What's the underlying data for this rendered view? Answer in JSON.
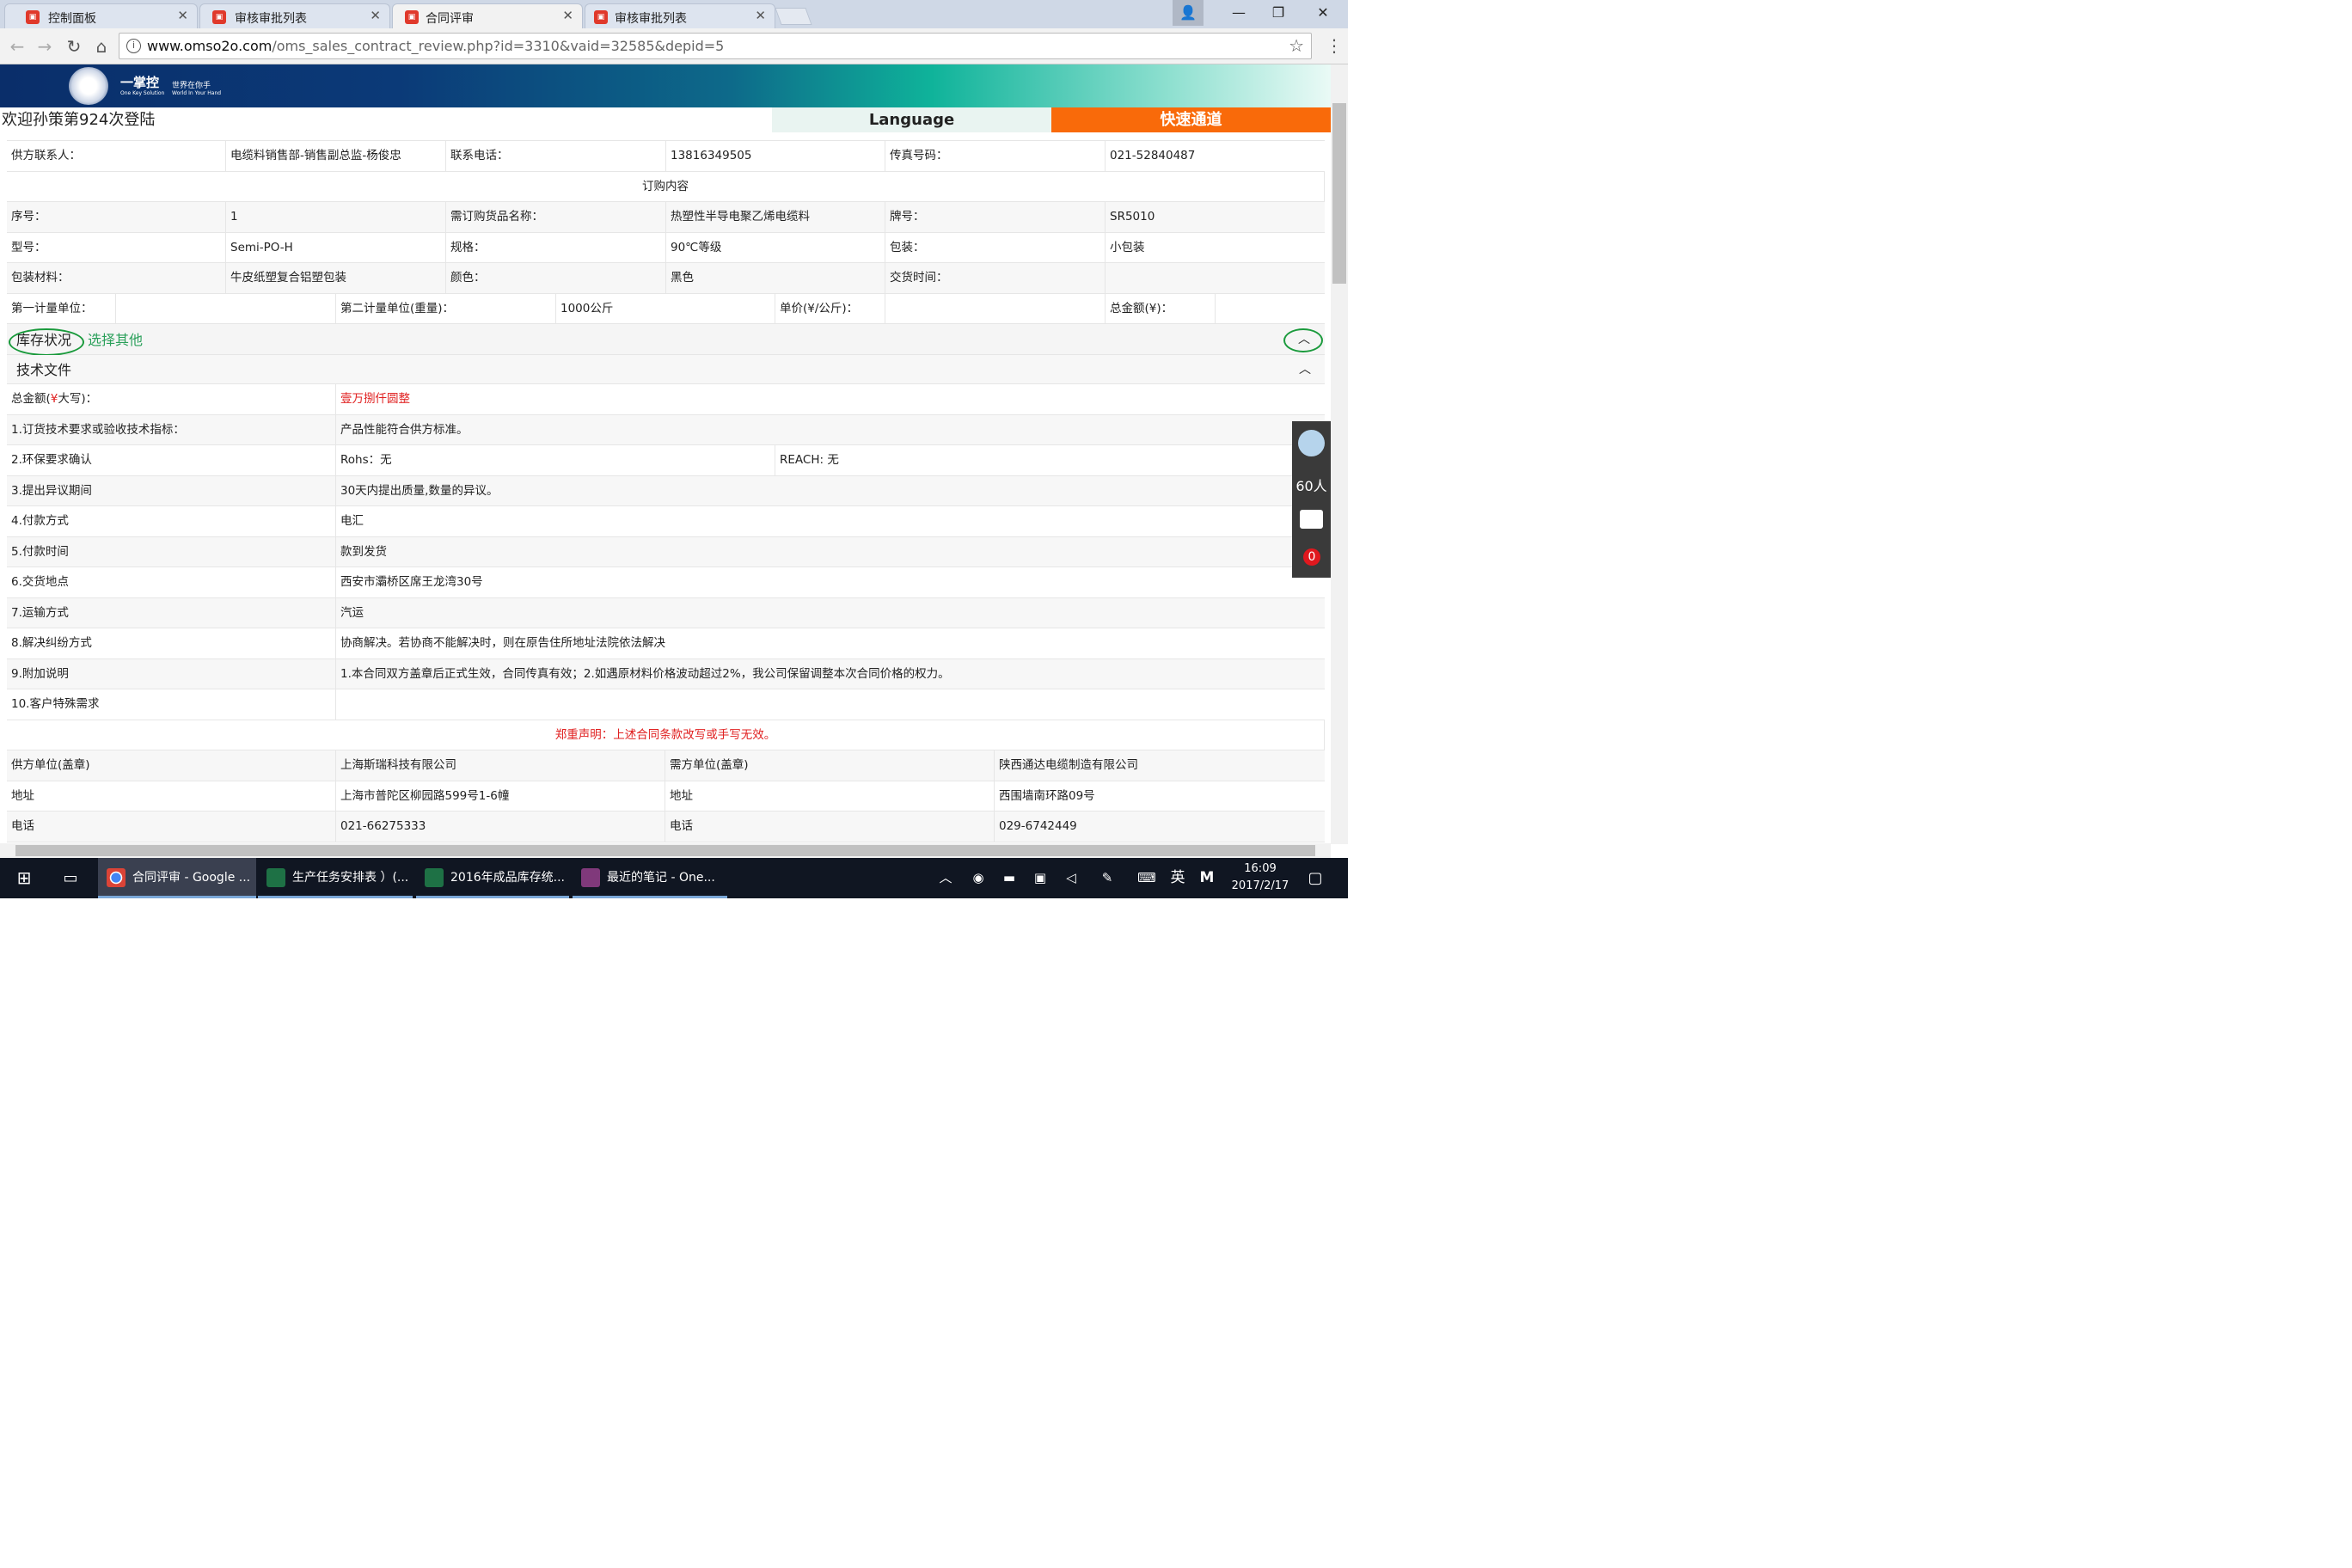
{
  "browser": {
    "tabs": [
      {
        "label": "控制面板",
        "active": false
      },
      {
        "label": "审核审批列表",
        "active": false
      },
      {
        "label": "合同评审",
        "active": true
      },
      {
        "label": "审核审批列表",
        "active": false
      }
    ],
    "url_host": "www.omso2o.com",
    "url_rest": "/oms_sales_contract_review.php?id=3310&vaid=32585&depid=5"
  },
  "banner": {
    "brand": "一掌控",
    "slogan": "世界在你手",
    "sub_brand": "One Key Solution",
    "sub_slogan": "World In Your Hand"
  },
  "header": {
    "welcome": "欢迎孙策第924次登陆",
    "language": "Language",
    "fast_channel": "快速通道"
  },
  "supplier_contact": {
    "label": "供方联系人：",
    "value": "电缆料销售部-销售副总监-杨俊忠",
    "phone_label": "联系电话：",
    "phone": "13816349505",
    "fax_label": "传真号码：",
    "fax": "021-52840487"
  },
  "order": {
    "section_title": "订购内容",
    "seq_label": "序号：",
    "seq": "1",
    "product_label": "需订购货品名称：",
    "product": "热塑性半导电聚乙烯电缆料",
    "brand_label": "牌号：",
    "brand": "SR5010",
    "model_label": "型号：",
    "model": "Semi-PO-H",
    "spec_label": "规格：",
    "spec": "90℃等级",
    "pack_label": "包装：",
    "pack": "小包装",
    "pack_material_label": "包装材料：",
    "pack_material": "牛皮纸塑复合铝塑包装",
    "color_label": "颜色：",
    "color": "黑色",
    "delivery_time_label": "交货时间：",
    "delivery_time": "",
    "unit1_label": "第一计量单位：",
    "unit1": "",
    "unit2_label": "第二计量单位(重量)：",
    "unit2": "1000公斤",
    "price_label": "单价(¥/公斤)：",
    "total_label": "总金额(¥)："
  },
  "inventory": {
    "label": "库存状况",
    "select_other": "选择其他"
  },
  "tech": {
    "label": "技术文件",
    "total_caps_label_pre": "总金额(",
    "total_caps_label_sym": "¥",
    "total_caps_label_post": "大写)：",
    "total_caps": "壹万捌仟圆整",
    "terms": [
      {
        "label": "1.订货技术要求或验收技术指标：",
        "value": "产品性能符合供方标准。"
      },
      {
        "label": "2.环保要求确认",
        "value": "Rohs：无",
        "value2": "REACH: 无"
      },
      {
        "label": "3.提出异议期间",
        "value": "30天内提出质量,数量的异议。"
      },
      {
        "label": "4.付款方式",
        "value": "电汇"
      },
      {
        "label": "5.付款时间",
        "value": "款到发货"
      },
      {
        "label": "6.交货地点",
        "value": "西安市灞桥区席王龙湾30号"
      },
      {
        "label": "7.运输方式",
        "value": "汽运"
      },
      {
        "label": "8.解决纠纷方式",
        "value": "协商解决。若协商不能解决时，则在原告住所地址法院依法解决"
      },
      {
        "label": "9.附加说明",
        "value": "1.本合同双方盖章后正式生效，合同传真有效；2.如遇原材料价格波动超过2%，我公司保留调整本次合同价格的权力。"
      },
      {
        "label": "10.客户特殊需求",
        "value": ""
      }
    ],
    "declaration": "郑重声明：上述合同条款改写或手写无效。"
  },
  "parties": {
    "supplier_label": "供方单位(盖章)",
    "supplier": "上海斯瑞科技有限公司",
    "buyer_label": "需方单位(盖章)",
    "buyer": "陕西通达电缆制造有限公司",
    "address_label": "地址",
    "supplier_address": "上海市普陀区柳园路599号1-6幢",
    "buyer_address": "西围墙南环路09号",
    "phone_label": "电话",
    "supplier_phone": "021-66275333",
    "buyer_phone": "029-6742449"
  },
  "side_widget": {
    "online_count": "60人",
    "messages": "0"
  },
  "taskbar": {
    "items": [
      {
        "label": "合同评审 - Google ..."
      },
      {
        "label": "生产任务安排表 ）(..."
      },
      {
        "label": "2016年成品库存统..."
      },
      {
        "label": "最近的笔记 - One..."
      }
    ],
    "ime": "英",
    "ime2": "M",
    "time": "16:09",
    "date": "2017/2/17"
  },
  "colors": {
    "accent_orange": "#f96a0a",
    "green": "#1a9a3c",
    "red": "#e02020"
  }
}
